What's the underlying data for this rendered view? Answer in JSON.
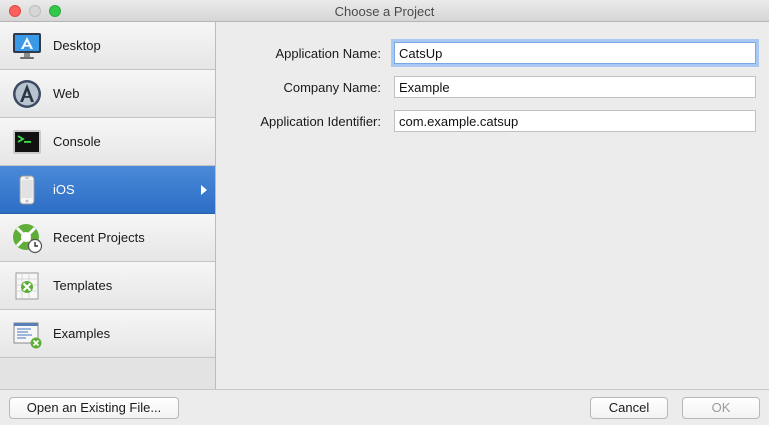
{
  "window": {
    "title": "Choose a Project"
  },
  "sidebar": {
    "items": [
      {
        "label": "Desktop",
        "icon": "desktop-app-icon"
      },
      {
        "label": "Web",
        "icon": "web-compass-icon"
      },
      {
        "label": "Console",
        "icon": "terminal-icon"
      },
      {
        "label": "iOS",
        "icon": "iphone-icon",
        "selected": true
      },
      {
        "label": "Recent Projects",
        "icon": "recent-projects-icon"
      },
      {
        "label": "Templates",
        "icon": "templates-icon"
      },
      {
        "label": "Examples",
        "icon": "examples-icon"
      }
    ]
  },
  "form": {
    "app_name_label": "Application Name:",
    "app_name_value": "CatsUp",
    "company_label": "Company Name:",
    "company_value": "Example",
    "identifier_label": "Application Identifier:",
    "identifier_value": "com.example.catsup"
  },
  "footer": {
    "open_existing_label": "Open an Existing File...",
    "cancel_label": "Cancel",
    "ok_label": "OK"
  },
  "colors": {
    "selection": "#2d6ec6",
    "focus_ring": "#a9c8f2"
  }
}
